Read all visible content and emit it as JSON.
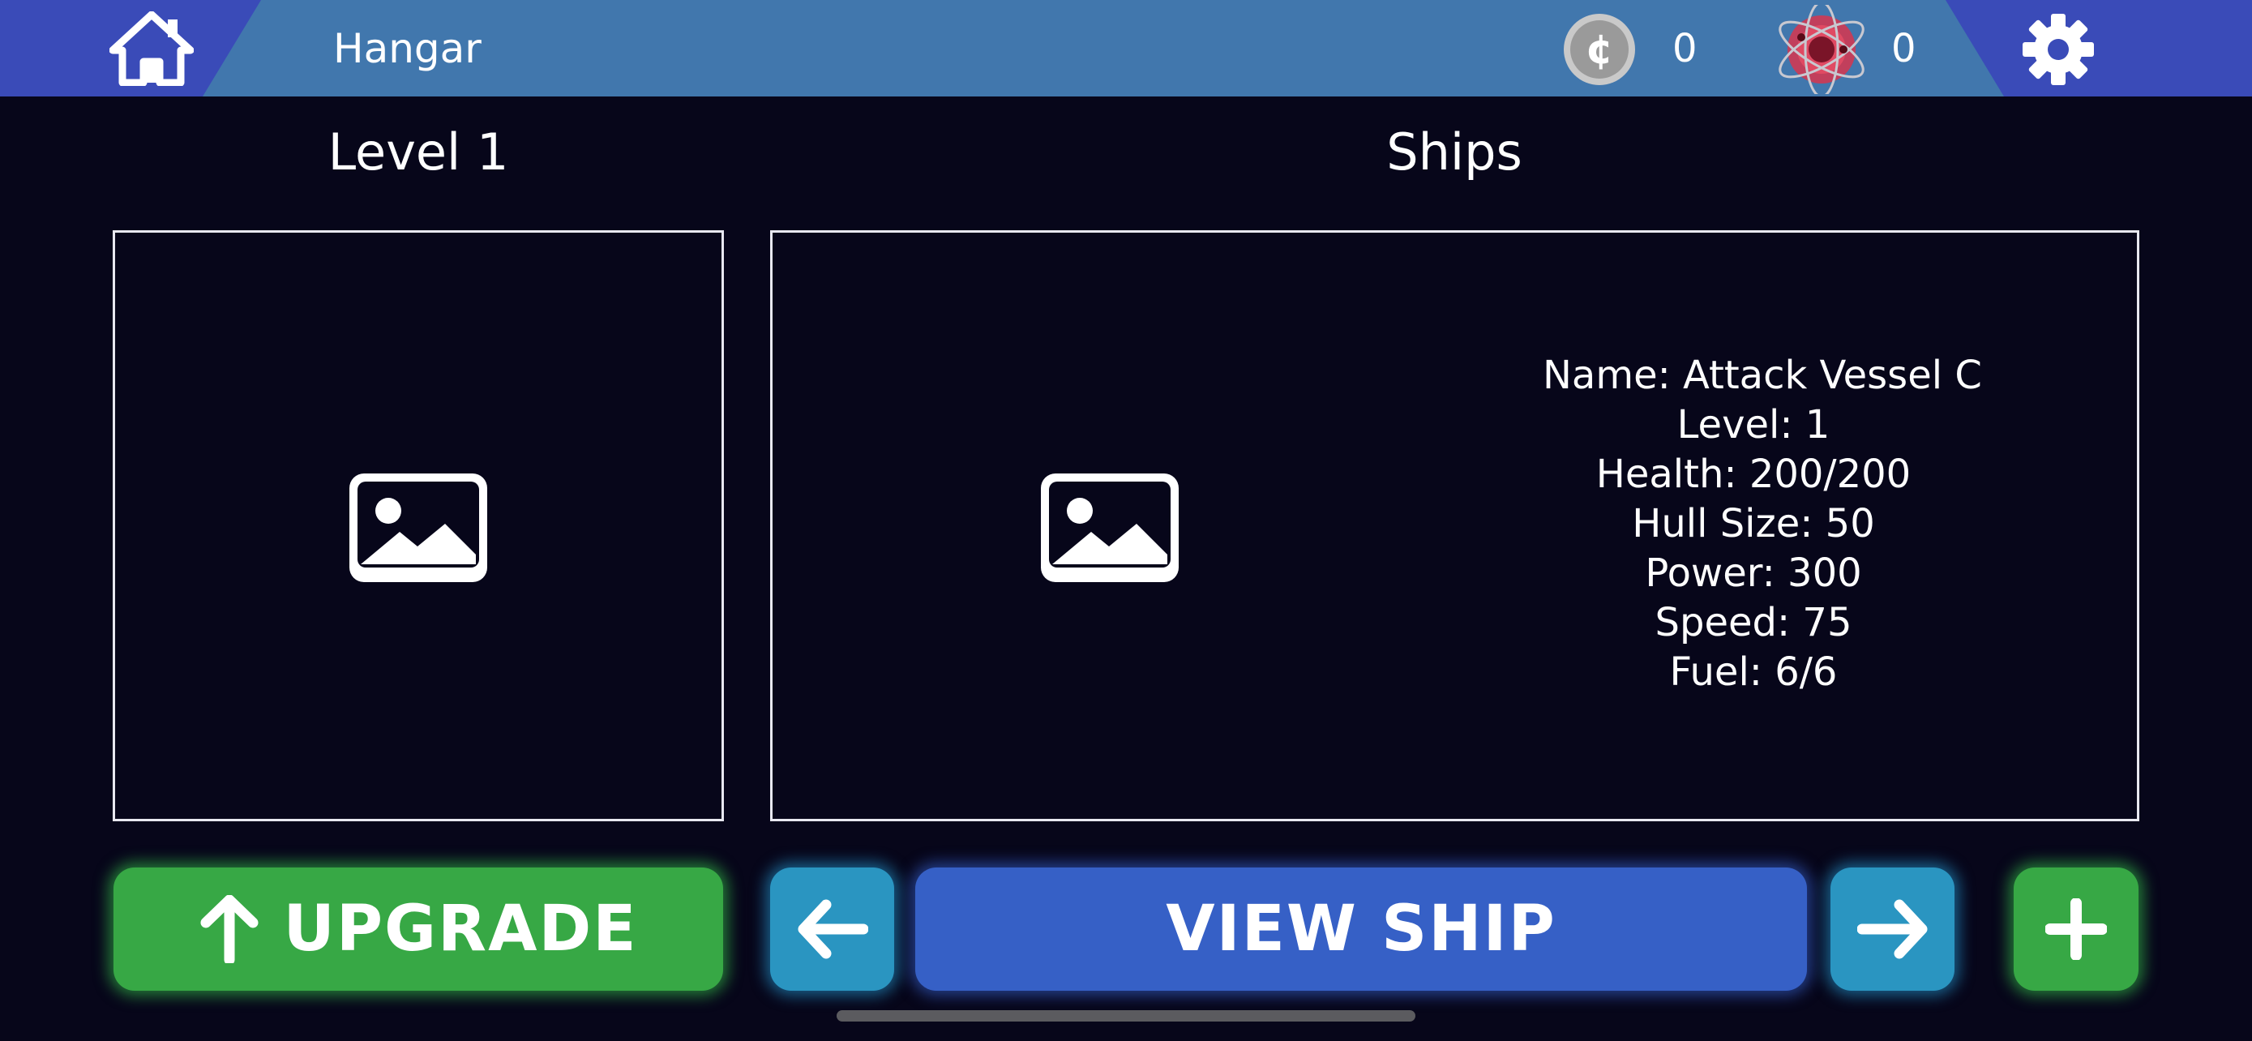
{
  "topbar": {
    "title": "Hangar",
    "coins": "0",
    "atoms": "0",
    "icons": {
      "home": "home-icon",
      "coin": "coin-icon",
      "atom": "atom-icon",
      "settings": "gear-icon"
    },
    "colors": {
      "bar_side": "#3a4bb8",
      "bar_center": "#4177ad"
    }
  },
  "level_panel": {
    "heading": "Level 1",
    "image": "image-placeholder-icon"
  },
  "ships_panel": {
    "heading": "Ships",
    "image": "image-placeholder-icon",
    "stats": [
      "Name: Attack Vessel C",
      "Level: 1",
      "Health: 200/200",
      "Hull Size: 50",
      "Power: 300",
      "Speed: 75",
      "Fuel: 6/6"
    ]
  },
  "buttons": {
    "upgrade": "UPGRADE",
    "view_ship": "VIEW SHIP",
    "icons": {
      "upgrade": "arrow-up-icon",
      "prev": "arrow-left-icon",
      "next": "arrow-right-icon",
      "add": "plus-icon"
    },
    "colors": {
      "green": "#37a845",
      "teal": "#2a95c1",
      "blue": "#3660c6"
    }
  }
}
